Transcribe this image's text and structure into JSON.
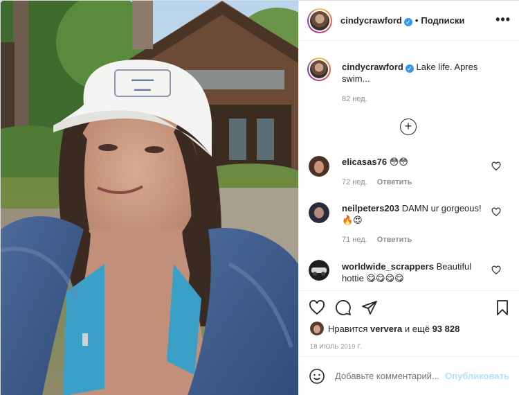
{
  "post": {
    "author": "cindycrawford",
    "follow_label": "Подписки",
    "more_label": "•••",
    "verified_mark": "✓",
    "separator": "•"
  },
  "caption": {
    "author": "cindycrawford",
    "text": "Lake life. Apres swim...",
    "time": "82 нед."
  },
  "load_more_label": "+",
  "comments": [
    {
      "user": "elicasas76",
      "text": "😳😳",
      "time": "72 нед.",
      "reply": "Ответить"
    },
    {
      "user": "neilpeters203",
      "text": "DAMN ur gorgeous! 🔥😍",
      "time": "71 нед.",
      "reply": "Ответить"
    },
    {
      "user": "worldwide_scrappers",
      "text": "Beautiful hottie 😋😋😋😋",
      "time": "",
      "reply": ""
    }
  ],
  "likes": {
    "prefix": "Нравится",
    "user": "ververa",
    "middle": "и ещё",
    "count": "93 828"
  },
  "date": "18 ИЮЛЬ 2019 Г.",
  "add_comment": {
    "placeholder": "Добавьте комментарий...",
    "publish_label": "Опубликовать"
  },
  "icons": {
    "like": "heart-icon",
    "comment": "comment-icon",
    "share": "paper-plane-icon",
    "save": "bookmark-icon",
    "emoji": "smiley-icon"
  },
  "colors": {
    "verified": "#3897f0",
    "muted": "#8e8e8e",
    "publish_disabled": "#b2dffc",
    "text": "#262626"
  }
}
